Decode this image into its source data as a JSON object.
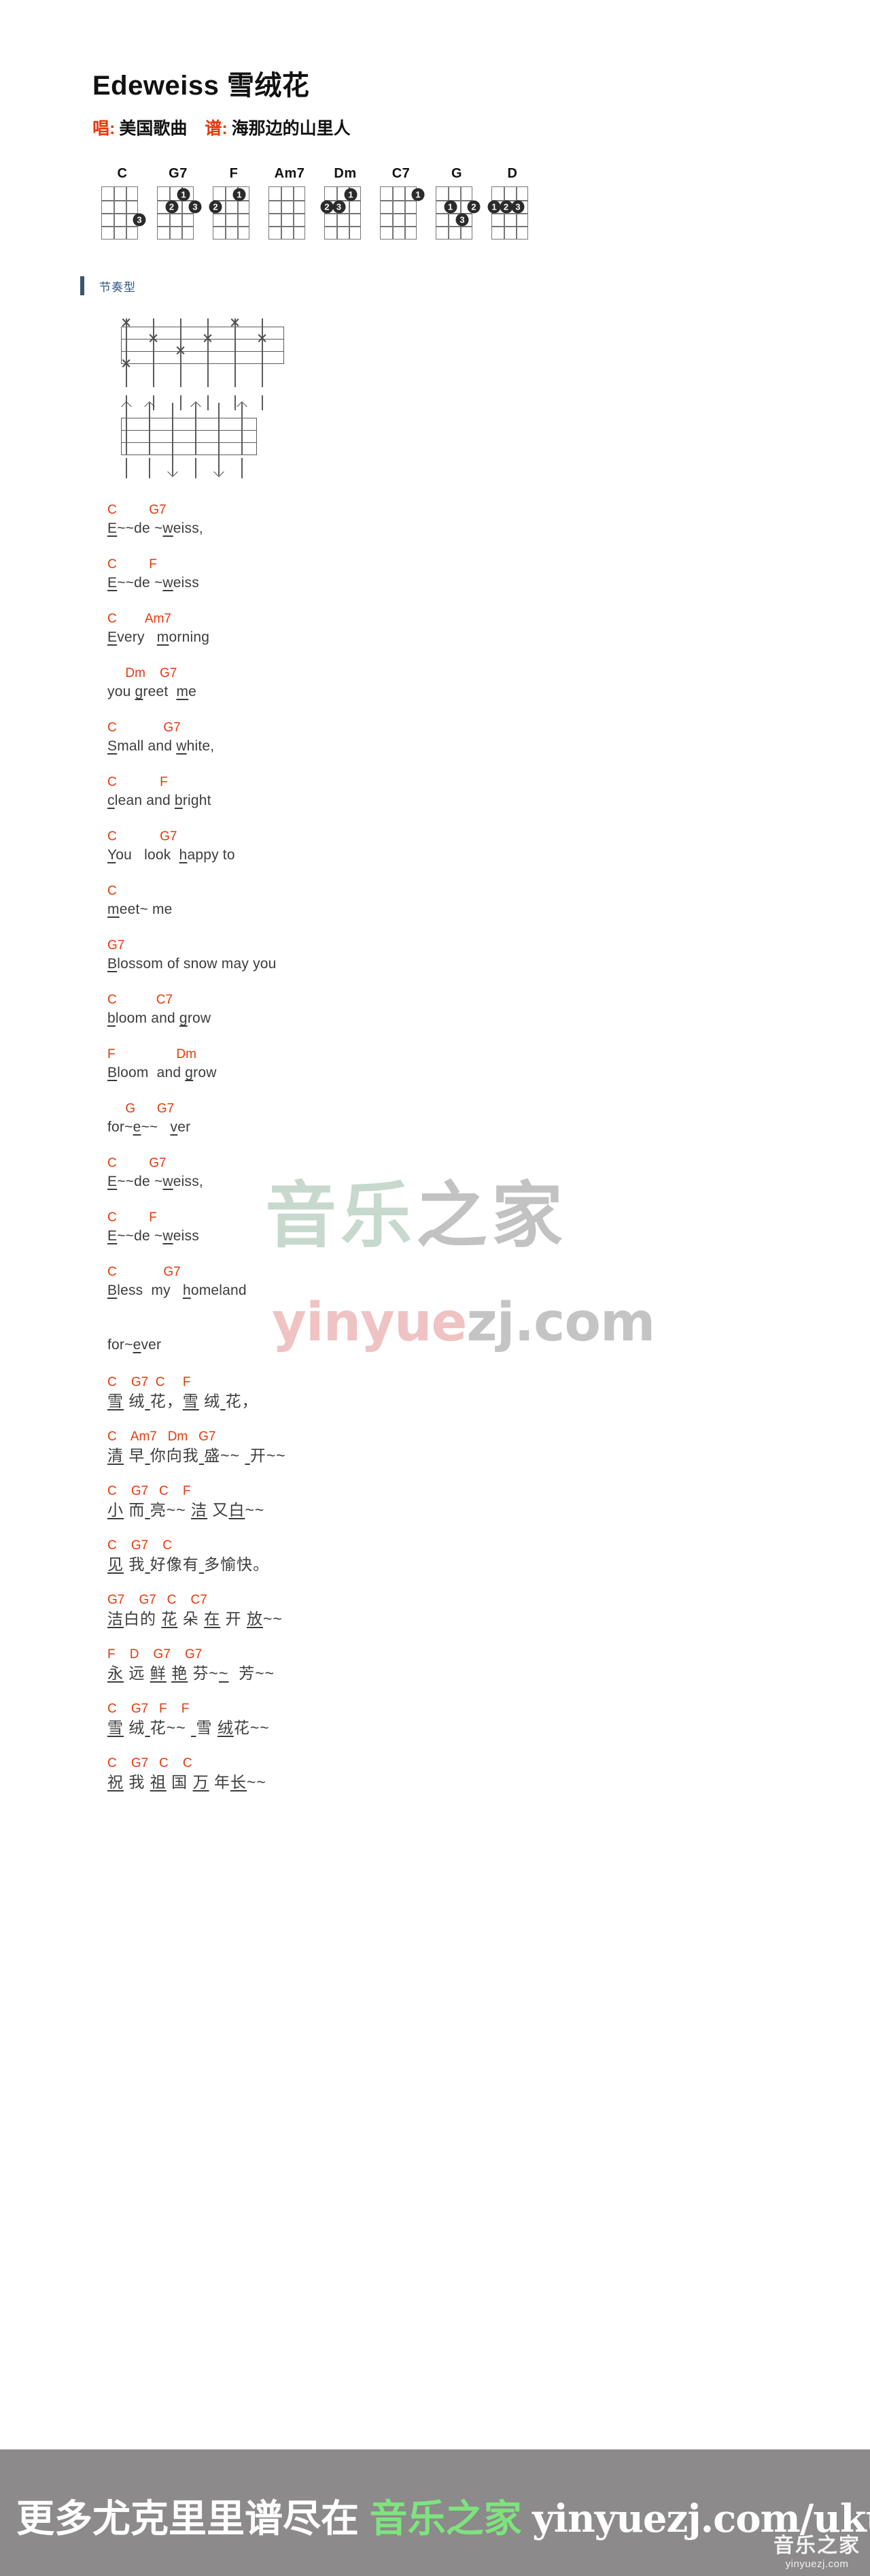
{
  "header": {
    "title": "Edeweiss 雪绒花",
    "singer_label": "唱:",
    "singer": "美国歌曲",
    "arranger_label": "谱:",
    "arranger": "海那边的山里人"
  },
  "chords": [
    {
      "name": "C",
      "dots": [
        {
          "string": 4,
          "fret": 3,
          "finger": "3"
        }
      ]
    },
    {
      "name": "G7",
      "dots": [
        {
          "string": 3,
          "fret": 1,
          "finger": "1"
        },
        {
          "string": 2,
          "fret": 2,
          "finger": "2"
        },
        {
          "string": 4,
          "fret": 2,
          "finger": "3"
        }
      ]
    },
    {
      "name": "F",
      "dots": [
        {
          "string": 3,
          "fret": 1,
          "finger": "1"
        },
        {
          "string": 1,
          "fret": 2,
          "finger": "2"
        }
      ]
    },
    {
      "name": "Am7",
      "dots": []
    },
    {
      "name": "Dm",
      "dots": [
        {
          "string": 3,
          "fret": 1,
          "finger": "1"
        },
        {
          "string": 1,
          "fret": 2,
          "finger": "2"
        },
        {
          "string": 2,
          "fret": 2,
          "finger": "3"
        }
      ]
    },
    {
      "name": "C7",
      "dots": [
        {
          "string": 4,
          "fret": 1,
          "finger": "1"
        }
      ]
    },
    {
      "name": "G",
      "dots": [
        {
          "string": 2,
          "fret": 2,
          "finger": "1"
        },
        {
          "string": 4,
          "fret": 2,
          "finger": "2"
        },
        {
          "string": 3,
          "fret": 3,
          "finger": "3"
        }
      ]
    },
    {
      "name": "D",
      "dots": [
        {
          "string": 1,
          "fret": 2,
          "finger": "1"
        },
        {
          "string": 2,
          "fret": 2,
          "finger": "2"
        },
        {
          "string": 3,
          "fret": 2,
          "finger": "3"
        }
      ]
    }
  ],
  "section": {
    "rhythm_title": "节奏型",
    "accent_color": "#3a556e"
  },
  "rhythm_patterns": [
    {
      "name": "fingerpick-pattern",
      "marks": [
        {
          "beat": 0,
          "string": 1,
          "type": "x"
        },
        {
          "beat": 0,
          "string": 4,
          "type": "x"
        },
        {
          "beat": 1,
          "string": 2,
          "type": "x"
        },
        {
          "beat": 2,
          "string": 3,
          "type": "x"
        },
        {
          "beat": 3,
          "string": 2,
          "type": "x"
        },
        {
          "beat": 4,
          "string": 1,
          "type": "x"
        },
        {
          "beat": 5,
          "string": 2,
          "type": "x"
        }
      ]
    },
    {
      "name": "strum-pattern",
      "strokes": [
        "up",
        "up",
        "down",
        "up",
        "down",
        "up"
      ]
    }
  ],
  "lyrics": [
    {
      "chords": "C         G7",
      "text": "E~~de ~weiss,",
      "underline": [
        [
          0,
          1
        ],
        [
          7,
          8
        ]
      ]
    },
    {
      "chords": "C         F",
      "text": "E~~de ~weiss",
      "underline": [
        [
          0,
          1
        ],
        [
          7,
          8
        ]
      ]
    },
    {
      "chords": "C        Am7",
      "text": "Every   morning",
      "underline": [
        [
          0,
          1
        ],
        [
          8,
          9
        ]
      ]
    },
    {
      "chords": "     Dm    G7",
      "text": "you greet  me",
      "underline": [
        [
          4,
          5
        ],
        [
          11,
          12
        ]
      ]
    },
    {
      "chords": "C             G7",
      "text": "Small and white,",
      "underline": [
        [
          0,
          1
        ],
        [
          10,
          11
        ]
      ]
    },
    {
      "chords": "C            F",
      "text": "clean and bright",
      "underline": [
        [
          0,
          1
        ],
        [
          10,
          11
        ]
      ]
    },
    {
      "chords": "C            G7",
      "text": "You   look  happy to",
      "underline": [
        [
          0,
          1
        ],
        [
          12,
          13
        ]
      ]
    },
    {
      "chords": "C",
      "text": "meet~ me",
      "underline": [
        [
          0,
          1
        ]
      ]
    },
    {
      "chords": "G7",
      "text": "Blossom of snow may you",
      "underline": [
        [
          0,
          1
        ]
      ]
    },
    {
      "chords": "C           C7",
      "text": "bloom and grow",
      "underline": [
        [
          0,
          1
        ],
        [
          10,
          11
        ]
      ]
    },
    {
      "chords": "F                 Dm",
      "text": "Bloom  and grow",
      "underline": [
        [
          0,
          1
        ],
        [
          11,
          12
        ]
      ]
    },
    {
      "chords": "     G      G7",
      "text": "for~e~~   ver",
      "underline": [
        [
          4,
          5
        ],
        [
          10,
          11
        ]
      ]
    },
    {
      "chords": "C         G7",
      "text": "E~~de ~weiss,",
      "underline": [
        [
          0,
          1
        ],
        [
          7,
          8
        ]
      ]
    },
    {
      "chords": "C         F",
      "text": "E~~de ~weiss",
      "underline": [
        [
          0,
          1
        ],
        [
          7,
          8
        ]
      ]
    },
    {
      "chords": "C             G7",
      "text": "Bless  my   homeland",
      "underline": [
        [
          0,
          1
        ],
        [
          12,
          13
        ]
      ]
    },
    {
      "chords": "",
      "text": "for~ever",
      "underline": [
        [
          4,
          5
        ]
      ]
    }
  ],
  "lyrics_cn": [
    {
      "chords": "C    G7  C     F",
      "text": "雪 绒 花，雪 绒 花，",
      "underline": [
        [
          0,
          1
        ],
        [
          3,
          4
        ],
        [
          6,
          7
        ],
        [
          9,
          10
        ]
      ]
    },
    {
      "chords": "C    Am7   Dm   G7",
      "text": "清 早 你向我 盛~~  开~~",
      "underline": [
        [
          0,
          1
        ],
        [
          3,
          4
        ],
        [
          7,
          8
        ],
        [
          12,
          13
        ]
      ]
    },
    {
      "chords": "C    G7   C    F",
      "text": "小 而 亮~~ 洁 又白~~",
      "underline": [
        [
          0,
          1
        ],
        [
          3,
          4
        ],
        [
          8,
          9
        ],
        [
          11,
          12
        ]
      ]
    },
    {
      "chords": "C    G7    C",
      "text": "见 我 好像有 多愉快。",
      "underline": [
        [
          0,
          1
        ],
        [
          3,
          4
        ],
        [
          7,
          8
        ]
      ]
    },
    {
      "chords": "G7    G7   C    C7",
      "text": "洁白的 花 朵 在 开 放~~",
      "underline": [
        [
          0,
          1
        ],
        [
          4,
          5
        ],
        [
          8,
          9
        ],
        [
          12,
          13
        ]
      ]
    },
    {
      "chords": "F    D    G7    G7",
      "text": "永 远 鲜 艳 芬~~  芳~~",
      "underline": [
        [
          0,
          1
        ],
        [
          4,
          5
        ],
        [
          6,
          7
        ],
        [
          10,
          11
        ]
      ]
    },
    {
      "chords": "C    G7   F    F",
      "text": "雪 绒 花~~  雪 绒花~~",
      "underline": [
        [
          0,
          1
        ],
        [
          3,
          4
        ],
        [
          8,
          9
        ],
        [
          11,
          12
        ]
      ]
    },
    {
      "chords": "C    G7   C    C",
      "text": "祝 我 祖 国 万 年长~~",
      "underline": [
        [
          0,
          1
        ],
        [
          4,
          5
        ],
        [
          8,
          9
        ],
        [
          11,
          12
        ]
      ]
    }
  ],
  "watermark": {
    "cn_part1": "音乐",
    "cn_part2": "之家",
    "url_part1": "yinyue",
    "url_part2": "zj.com"
  },
  "footer": {
    "text": "更多尤克里里谱尽在",
    "brand": "音乐之家",
    "url": "yinyuezj.com/ukulele",
    "badge_cn": "音乐之家",
    "badge_url": "yinyuezj.com",
    "bg_color": "#8c8a8a",
    "brand_color": "#7ee37e"
  }
}
